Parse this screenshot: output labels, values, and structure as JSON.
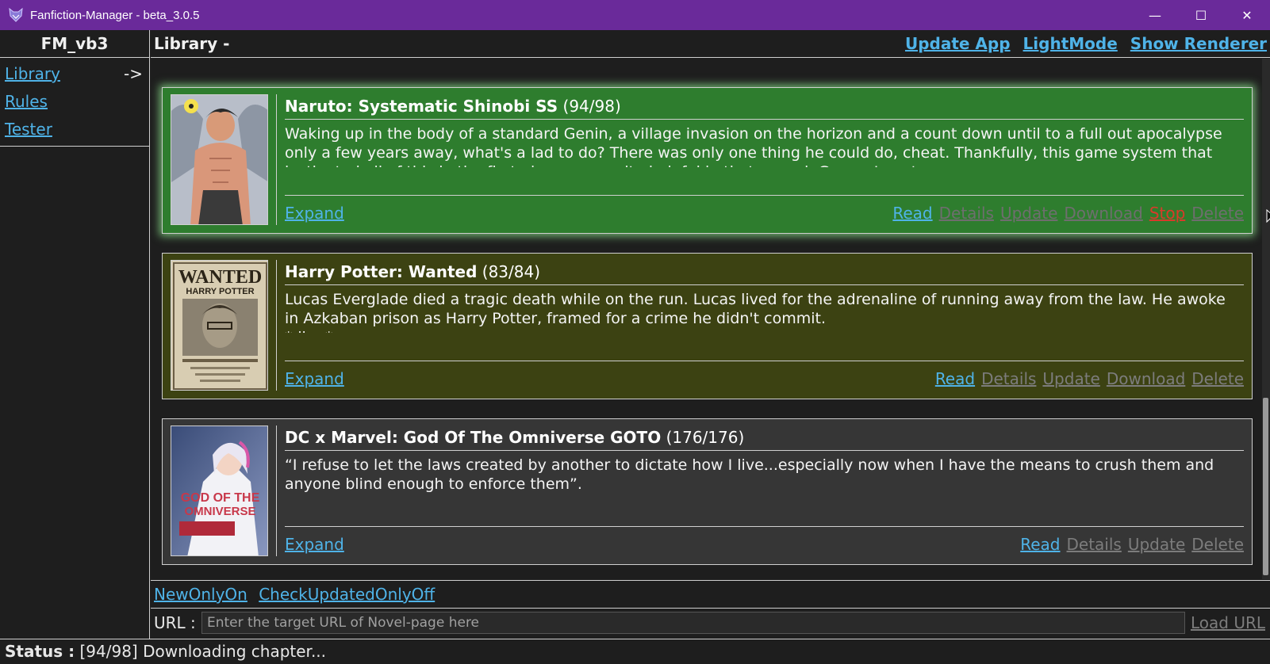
{
  "window": {
    "title": "Fanfiction-Manager - beta_3.0.5",
    "minimize": "—",
    "maximize": "☐",
    "close": "✕"
  },
  "sidebar": {
    "brand": "FM_vb3",
    "items": [
      {
        "label": "Library",
        "arrow": "->"
      },
      {
        "label": "Rules"
      },
      {
        "label": "Tester"
      }
    ]
  },
  "header": {
    "title": "Library -",
    "actions": [
      "Update App",
      "LightMode",
      "Show Renderer"
    ]
  },
  "stories": [
    {
      "title": "Naruto: Systematic Shinobi SS",
      "progress": "(94/98)",
      "summary": "Waking up in the body of a standard Genin, a village invasion on the horizon and a count down until to a full out apocalypse only a few years away, what's a lad to do? There was only one thing he could do, cheat. Thankfully, this game system that instigated all of this in the first place, was quite helpful in that regard. Gamer Insert.",
      "expand": "Expand",
      "actions": [
        "Read",
        "Details",
        "Update",
        "Download",
        "Stop",
        "Delete"
      ],
      "bg": "#2e7d2e"
    },
    {
      "title": "Harry Potter: Wanted",
      "progress": "(83/84)",
      "summary": "Lucas Everglade died a tragic death while on the run. Lucas lived for the adrenaline of running away from the law. He awoke in Azkaban prison as Harry Potter, framed for a crime he didn't commit.\n*ding*",
      "expand": "Expand",
      "actions": [
        "Read",
        "Details",
        "Update",
        "Download",
        "Delete"
      ],
      "cover_text": {
        "top": "WANTED",
        "sub": "HARRY POTTER"
      },
      "bg": "#3c4212"
    },
    {
      "title": "DC x Marvel: God Of The Omniverse GOTO",
      "progress": "(176/176)",
      "summary": "“I refuse to let the laws created by another to dictate how I live...especially now when I have the means to crush them and anyone blind enough to enforce them”.",
      "expand": "Expand",
      "actions": [
        "Read",
        "Details",
        "Update",
        "Delete"
      ],
      "cover_text": {
        "line1": "GOD OF THE",
        "line2": "OMNIVERSE"
      },
      "bg": "#363636"
    }
  ],
  "toggles": [
    "NewOnlyOn",
    "CheckUpdatedOnlyOff"
  ],
  "url": {
    "label": "URL :",
    "placeholder": "Enter the target URL of Novel-page here",
    "load": "Load URL"
  },
  "status": {
    "label": "Status :",
    "text": "[94/98] Downloading chapter..."
  },
  "colors": {
    "titlebar": "#6a2a9a",
    "link": "#4fb3e8",
    "disabled": "#7c7c7c",
    "stop": "#d83a2a"
  }
}
